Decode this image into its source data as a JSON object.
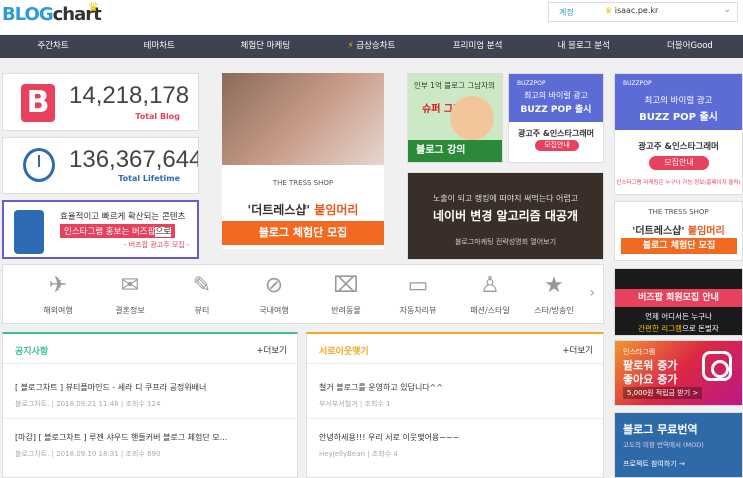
{
  "header": {
    "logo_blog": "BLOG",
    "logo_chart": "chart",
    "user_label": "계정",
    "user_value": "isaac.pe.kr"
  },
  "nav": {
    "items": [
      "주간차트",
      "테마차트",
      "체험단 마케팅",
      "급상승차트",
      "프리미엄 분석",
      "내 블로그 분석",
      "더블어Good"
    ]
  },
  "stats": {
    "blog_count": "14,218,178",
    "blog_label": "Total Blog",
    "lifetime_count": "136,367,644",
    "lifetime_label": "Total Lifetime"
  },
  "ad_insta": {
    "line1": "효율적이고 빠르게 확산되는 콘텐츠",
    "line2": "인스타그램 홍보는 버즈팝",
    "line2b": "으로",
    "line3": "- 버즈팝 광고주 모집 -"
  },
  "tress": {
    "shop": "THE TRESS SHOP",
    "title_a": "'더트레스샵'",
    "title_b": "붙임머리",
    "button": "블로그 체험단 모집"
  },
  "green_ad": {
    "line1": "인부 1억 블로그 그남자의",
    "line2": "슈퍼 그레잇",
    "line3": "블로그 강의"
  },
  "buzz_top": {
    "brand": "BUZZPOP",
    "line1": "최고의 바이럴 광고",
    "line2": "BUZZ POP 출시",
    "line3": "광고주 &인스타그래머",
    "button": "모집안내"
  },
  "dark_ad": {
    "line1": "노출이 되고 랭킹에 떠야지 써먹는다 어렵고",
    "line2": "네이버 변경 알고리즘 대공개",
    "line3": "블로그마케팅 전략성명회 열어보기"
  },
  "categories": [
    "해외여행",
    "결혼정보",
    "뷰티",
    "국내여행",
    "반려동물",
    "자동차리뷰",
    "패션/스타일",
    "스타/방송인"
  ],
  "notice": {
    "title": "공지사항",
    "more": "+더보기",
    "posts": [
      {
        "title": "[ 블로그차트 ] 뷰티플마인드 - 세라 디 쿠프라 공정위배너",
        "meta": "블로그차트.  |  2018.09.21 11:48  |  조회수 124"
      },
      {
        "title": "[마감] [ 블로그차트 ] 루젠 샤우드 핸들커버 블로그 체험단 모...",
        "meta": "블로그차트.  |  2018.09.10 18:31  |  조회수 690"
      }
    ]
  },
  "neighbor": {
    "title": "서로이웃맺기",
    "more": "+더보기",
    "posts": [
      {
        "title": "철거 블로그를 운영하고 있답니다^^",
        "meta": "부서부서철거  |  조회수 1"
      },
      {
        "title": "안녕하세용!!! 우리 서로 이웃맺어용~~~",
        "meta": "HeyJellyBean  |  조회수 4"
      }
    ]
  },
  "right_buzz": {
    "brand": "BUZZPOP",
    "line1": "최고의 바이럴 광고",
    "line2": "BUZZ POP 출시",
    "line3": "광고주 &인스타그래머",
    "button": "모집안내",
    "line4": "인스타그램 마케팅은 누구나 가능 정보(홈페이지 클릭)"
  },
  "right_tress": {
    "shop": "THE TRESS SHOP",
    "title_a": "'더트레스샵'",
    "title_b": "붙임머리",
    "button": "블로그 체험단 모집"
  },
  "right_buzz2": {
    "banner": "버즈팝 회원모집 안내",
    "line1": "언제 어디서든 누구나",
    "line2a": "간편한 리그램",
    "line2b": "으로 돈벌자"
  },
  "right_insta": {
    "line1": "인스타그램",
    "line2": "팔로워 증가",
    "line3": "좋아요 증가",
    "line4": "5,000원 적립금 받기 >"
  },
  "right_blue": {
    "line1": "블로그 무료번역",
    "line2": "고도의 미항 번역에서 (MOD)",
    "line3": "프로젝트 참여하기 →"
  }
}
